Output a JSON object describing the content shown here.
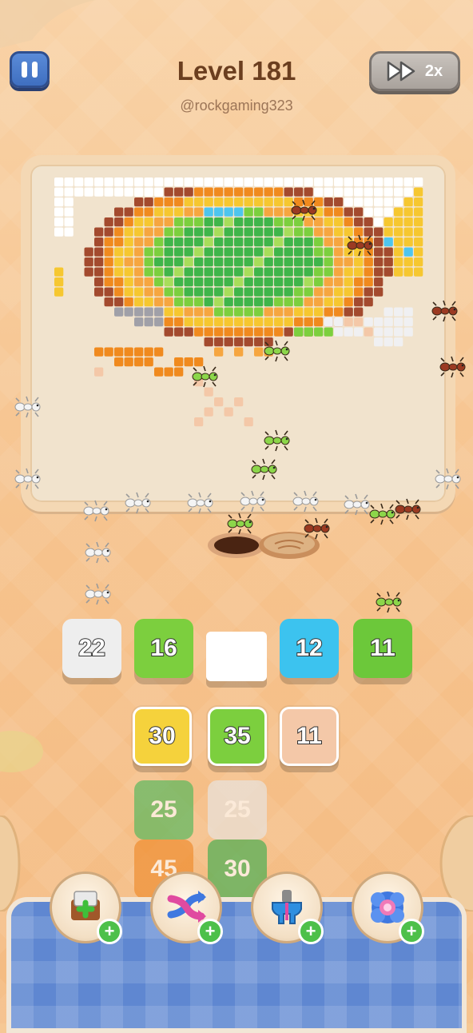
{
  "header": {
    "level_title": "Level 181",
    "username": "@rockgaming323",
    "speed_label": "2x"
  },
  "icons": {
    "pause": "pause-icon",
    "speed": "fast-forward-icon",
    "powerups": [
      "add-box-icon",
      "shuffle-arrows-icon",
      "magnet-icon",
      "ring-icon"
    ]
  },
  "slots": [
    {
      "value": "22",
      "color": "#eeeeee"
    },
    {
      "value": "16",
      "color": "#7ccf3e"
    },
    {
      "value": "",
      "color": "#ffffff"
    },
    {
      "value": "12",
      "color": "#3cc3ef"
    },
    {
      "value": "11",
      "color": "#6cc83a"
    }
  ],
  "queue": {
    "row1": [
      {
        "value": "30",
        "color": "#f5d23c"
      },
      {
        "value": "35",
        "color": "#7ccf3e"
      },
      {
        "value": "11",
        "color": "#f4c8a8"
      }
    ],
    "row2": [
      {
        "value": "25",
        "color": "#4fb85a"
      },
      {
        "value": "25",
        "color": "#e8e6e4"
      }
    ],
    "row3": [
      {
        "value": "45",
        "color": "#ef8a2a"
      },
      {
        "value": "30",
        "color": "#3fae4f"
      }
    ]
  },
  "colors": {
    "brand_blue": "#4a7bd0",
    "text_brown": "#6b3e1f",
    "plus_green": "#4dc04a"
  }
}
